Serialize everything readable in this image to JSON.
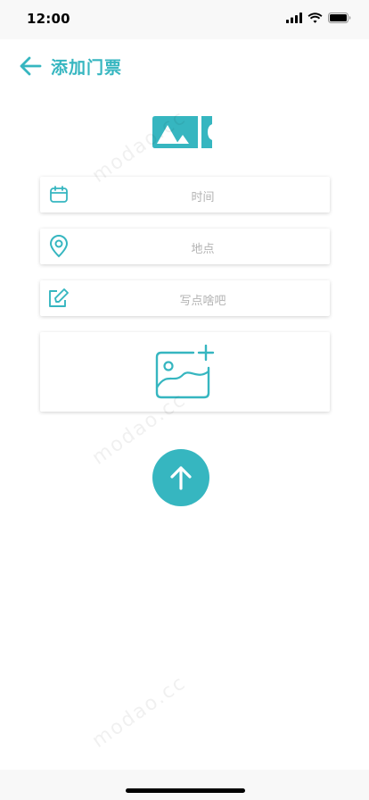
{
  "status_bar": {
    "time": "12:00",
    "icons": [
      "signal-icon",
      "wifi-icon",
      "battery-icon"
    ]
  },
  "header": {
    "back_icon": "arrow-left-icon",
    "title": "添加门票"
  },
  "logo": {
    "icon": "ticket-icon"
  },
  "form": {
    "time_field": {
      "icon": "calendar-icon",
      "placeholder": "时间"
    },
    "location_field": {
      "icon": "location-pin-icon",
      "placeholder": "地点"
    },
    "note_field": {
      "icon": "edit-icon",
      "placeholder": "写点啥吧"
    },
    "image_upload": {
      "icon": "add-image-icon"
    }
  },
  "submit": {
    "icon": "arrow-up-icon"
  },
  "watermark": {
    "text": "modao.cc"
  },
  "colors": {
    "accent": "#36b6c0",
    "placeholder": "#b3b3b3"
  }
}
